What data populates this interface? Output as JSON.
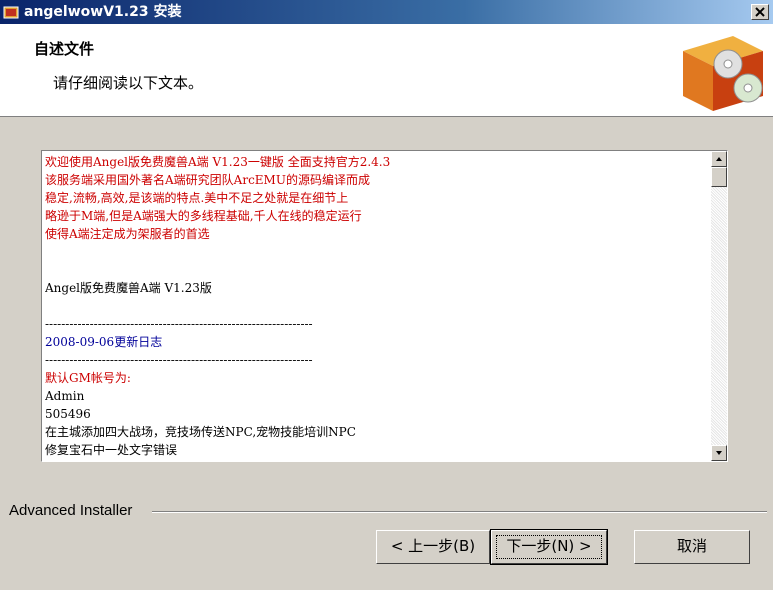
{
  "window": {
    "title": "angelwowV1.23 安装"
  },
  "header": {
    "title": "自述文件",
    "subtitle": "请仔细阅读以下文本。"
  },
  "readme": {
    "lines": [
      {
        "text": "欢迎使用Angel版免费魔兽A端 V1.23一键版 全面支持官方2.4.3",
        "color": "red"
      },
      {
        "text": "该服务端采用国外著名A端研究团队ArcEMU的源码编译而成",
        "color": "red"
      },
      {
        "text": "稳定,流畅,高效,是该端的特点.美中不足之处就是在细节上",
        "color": "red"
      },
      {
        "text": "略逊于M端,但是A端强大的多线程基础,千人在线的稳定运行",
        "color": "red"
      },
      {
        "text": "使得A端注定成为架服者的首选",
        "color": "red"
      },
      {
        "text": "",
        "color": "black"
      },
      {
        "text": "",
        "color": "black"
      },
      {
        "text": "Angel版免费魔兽A端 V1.23版",
        "color": "black"
      },
      {
        "text": "",
        "color": "black"
      },
      {
        "text": "------------------------------------------------------------------",
        "color": "black"
      },
      {
        "text": "2008-09-06更新日志",
        "color": "blue"
      },
      {
        "text": "------------------------------------------------------------------",
        "color": "black"
      },
      {
        "text": "默认GM帐号为:",
        "color": "red"
      },
      {
        "text": "Admin",
        "color": "black"
      },
      {
        "text": "505496",
        "color": "black"
      },
      {
        "text": "在主城添加四大战场，竞技场传送NPC,宠物技能培训NPC",
        "color": "black"
      },
      {
        "text": "修复宝石中一处文字错误",
        "color": "black"
      },
      {
        "text": "",
        "color": "black"
      }
    ]
  },
  "footer": {
    "brand": "Advanced Installer",
    "back_label": "< 上一步(B)",
    "next_label": "下一步(N) >",
    "cancel_label": "取消"
  }
}
